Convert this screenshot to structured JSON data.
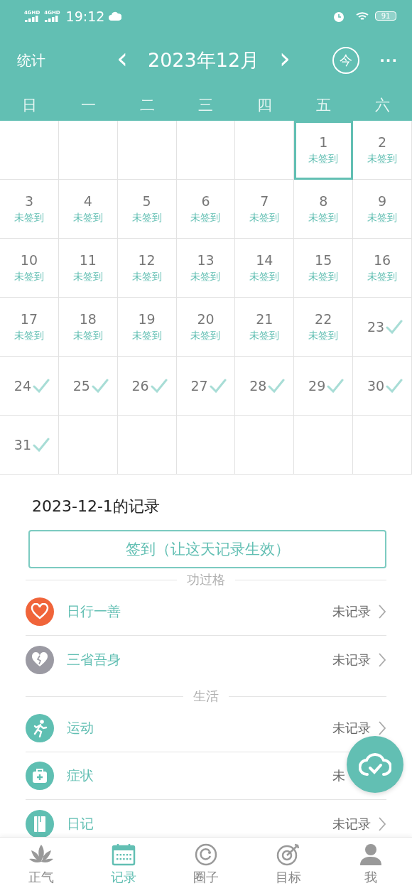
{
  "status_bar": {
    "signals": [
      "4GHD",
      "4GHD"
    ],
    "time": "19:12",
    "battery": "91"
  },
  "header": {
    "left": "统计",
    "title": "2023年12月",
    "prev": "‹",
    "next": "›",
    "today": "今",
    "more": "···"
  },
  "weekdays": [
    "日",
    "一",
    "二",
    "三",
    "四",
    "五",
    "六"
  ],
  "calendar": {
    "weeks": [
      [
        {
          "kind": "empty"
        },
        {
          "kind": "empty"
        },
        {
          "kind": "empty"
        },
        {
          "kind": "empty"
        },
        {
          "kind": "empty"
        },
        {
          "kind": "day",
          "day": "1",
          "status": "未签到",
          "checked": false,
          "selected": true
        },
        {
          "kind": "day",
          "day": "2",
          "status": "未签到",
          "checked": false,
          "selected": false
        }
      ],
      [
        {
          "kind": "day",
          "day": "3",
          "status": "未签到",
          "checked": false,
          "selected": false
        },
        {
          "kind": "day",
          "day": "4",
          "status": "未签到",
          "checked": false,
          "selected": false
        },
        {
          "kind": "day",
          "day": "5",
          "status": "未签到",
          "checked": false,
          "selected": false
        },
        {
          "kind": "day",
          "day": "6",
          "status": "未签到",
          "checked": false,
          "selected": false
        },
        {
          "kind": "day",
          "day": "7",
          "status": "未签到",
          "checked": false,
          "selected": false
        },
        {
          "kind": "day",
          "day": "8",
          "status": "未签到",
          "checked": false,
          "selected": false
        },
        {
          "kind": "day",
          "day": "9",
          "status": "未签到",
          "checked": false,
          "selected": false
        }
      ],
      [
        {
          "kind": "day",
          "day": "10",
          "status": "未签到",
          "checked": false,
          "selected": false
        },
        {
          "kind": "day",
          "day": "11",
          "status": "未签到",
          "checked": false,
          "selected": false
        },
        {
          "kind": "day",
          "day": "12",
          "status": "未签到",
          "checked": false,
          "selected": false
        },
        {
          "kind": "day",
          "day": "13",
          "status": "未签到",
          "checked": false,
          "selected": false
        },
        {
          "kind": "day",
          "day": "14",
          "status": "未签到",
          "checked": false,
          "selected": false
        },
        {
          "kind": "day",
          "day": "15",
          "status": "未签到",
          "checked": false,
          "selected": false
        },
        {
          "kind": "day",
          "day": "16",
          "status": "未签到",
          "checked": false,
          "selected": false
        }
      ],
      [
        {
          "kind": "day",
          "day": "17",
          "status": "未签到",
          "checked": false,
          "selected": false
        },
        {
          "kind": "day",
          "day": "18",
          "status": "未签到",
          "checked": false,
          "selected": false
        },
        {
          "kind": "day",
          "day": "19",
          "status": "未签到",
          "checked": false,
          "selected": false
        },
        {
          "kind": "day",
          "day": "20",
          "status": "未签到",
          "checked": false,
          "selected": false
        },
        {
          "kind": "day",
          "day": "21",
          "status": "未签到",
          "checked": false,
          "selected": false
        },
        {
          "kind": "day",
          "day": "22",
          "status": "未签到",
          "checked": false,
          "selected": false
        },
        {
          "kind": "day",
          "day": "23",
          "checked": true,
          "selected": false
        }
      ],
      [
        {
          "kind": "day",
          "day": "24",
          "checked": true,
          "selected": false
        },
        {
          "kind": "day",
          "day": "25",
          "checked": true,
          "selected": false
        },
        {
          "kind": "day",
          "day": "26",
          "checked": true,
          "selected": false
        },
        {
          "kind": "day",
          "day": "27",
          "checked": true,
          "selected": false
        },
        {
          "kind": "day",
          "day": "28",
          "checked": true,
          "selected": false
        },
        {
          "kind": "day",
          "day": "29",
          "checked": true,
          "selected": false
        },
        {
          "kind": "day",
          "day": "30",
          "checked": true,
          "selected": false
        }
      ],
      [
        {
          "kind": "day",
          "day": "31",
          "checked": true,
          "selected": false
        },
        {
          "kind": "empty"
        },
        {
          "kind": "empty"
        },
        {
          "kind": "empty"
        },
        {
          "kind": "empty"
        },
        {
          "kind": "empty"
        },
        {
          "kind": "empty"
        }
      ]
    ]
  },
  "record": {
    "title": "2023-12-1的记录",
    "checkin_button": "签到（让这天记录生效）",
    "sections": [
      {
        "title": "功过格",
        "items": [
          {
            "label": "日行一善",
            "value": "未记录",
            "chevron": true,
            "color": "#f0643a"
          },
          {
            "label": "三省吾身",
            "value": "未记录",
            "chevron": true,
            "color": "#9b9aa3"
          }
        ]
      },
      {
        "title": "生活",
        "items": [
          {
            "label": "运动",
            "value": "未记录",
            "chevron": true,
            "color": "#5fbfb2"
          },
          {
            "label": "症状",
            "value": "未",
            "chevron": false,
            "color": "#5fbfb2"
          },
          {
            "label": "日记",
            "value": "未记录",
            "chevron": true,
            "color": "#5fbfb2"
          }
        ]
      }
    ]
  },
  "nav": [
    {
      "label": "正气",
      "selected": false
    },
    {
      "label": "记录",
      "selected": true
    },
    {
      "label": "圈子",
      "selected": false
    },
    {
      "label": "目标",
      "selected": false
    },
    {
      "label": "我",
      "selected": false
    }
  ]
}
